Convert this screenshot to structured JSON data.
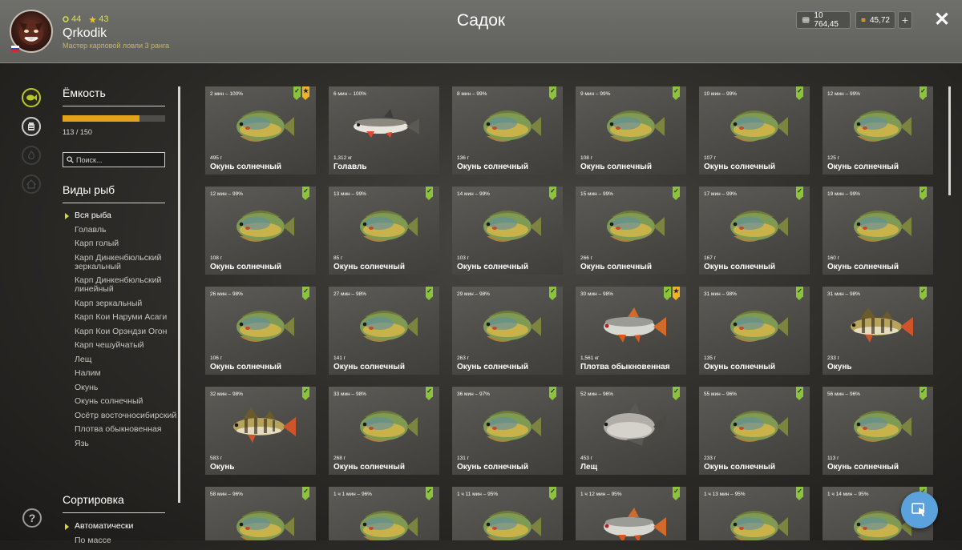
{
  "header": {
    "title": "Садок",
    "username": "Qrkodik",
    "rank": "Мастер карповой ловли 3 ранга",
    "level": "44",
    "stars": "43",
    "silver": "10 764,45",
    "gold": "45,72",
    "plus": "+",
    "close": "✕"
  },
  "sidebar": {
    "capacity_title": "Ёмкость",
    "capacity_text": "113 / 150",
    "capacity_fraction": 0.753,
    "search_placeholder": "Поиск...",
    "species_title": "Виды рыб",
    "species": [
      "Вся рыба",
      "Голавль",
      "Карп голый",
      "Карп Динкенбюльский зеркальный",
      "Карп Динкенбюльский линейный",
      "Карп зеркальный",
      "Карп Кои Наруми Асаги",
      "Карп Кои Орэндзи Огон",
      "Карп чешуйчатый",
      "Лещ",
      "Налим",
      "Окунь",
      "Окунь солнечный",
      "Осётр восточносибирский",
      "Плотва обыкновенная",
      "Язь"
    ],
    "sort_title": "Сортировка",
    "sort_options": [
      "Автоматически",
      "По массе"
    ],
    "help": "?"
  },
  "colors": {
    "accent": "#b7c92a",
    "capacity_bar": "#e2a21c",
    "badge_green": "#8bc43a",
    "badge_orange": "#f0b322",
    "fab": "#5ba1dc"
  },
  "cards": [
    {
      "time": "2 мин – 100%",
      "weight": "495 г",
      "name": "Окунь солнечный",
      "fish": "sunfish",
      "badges": [
        "green",
        "orange"
      ]
    },
    {
      "time": "6 мин – 100%",
      "weight": "1,312 кг",
      "name": "Голавль",
      "fish": "chub",
      "badges": []
    },
    {
      "time": "8 мин – 99%",
      "weight": "136 г",
      "name": "Окунь солнечный",
      "fish": "sunfish",
      "badges": [
        "green"
      ]
    },
    {
      "time": "9 мин – 99%",
      "weight": "108 г",
      "name": "Окунь солнечный",
      "fish": "sunfish",
      "badges": [
        "green"
      ]
    },
    {
      "time": "10 мин – 99%",
      "weight": "107 г",
      "name": "Окунь солнечный",
      "fish": "sunfish",
      "badges": [
        "green"
      ]
    },
    {
      "time": "12 мин – 99%",
      "weight": "125 г",
      "name": "Окунь солнечный",
      "fish": "sunfish",
      "badges": [
        "green"
      ]
    },
    {
      "time": "12 мин – 99%",
      "weight": "108 г",
      "name": "Окунь солнечный",
      "fish": "sunfish",
      "badges": [
        "green"
      ]
    },
    {
      "time": "13 мин – 99%",
      "weight": "85 г",
      "name": "Окунь солнечный",
      "fish": "sunfish",
      "badges": [
        "green"
      ]
    },
    {
      "time": "14 мин – 99%",
      "weight": "103 г",
      "name": "Окунь солнечный",
      "fish": "sunfish",
      "badges": [
        "green"
      ]
    },
    {
      "time": "15 мин – 99%",
      "weight": "266 г",
      "name": "Окунь солнечный",
      "fish": "sunfish",
      "badges": [
        "green"
      ]
    },
    {
      "time": "17 мин – 99%",
      "weight": "167 г",
      "name": "Окунь солнечный",
      "fish": "sunfish",
      "badges": [
        "green"
      ]
    },
    {
      "time": "19 мин – 99%",
      "weight": "160 г",
      "name": "Окунь солнечный",
      "fish": "sunfish",
      "badges": [
        "green"
      ]
    },
    {
      "time": "26 мин – 98%",
      "weight": "106 г",
      "name": "Окунь солнечный",
      "fish": "sunfish",
      "badges": [
        "green"
      ]
    },
    {
      "time": "27 мин – 98%",
      "weight": "141 г",
      "name": "Окунь солнечный",
      "fish": "sunfish",
      "badges": [
        "green"
      ]
    },
    {
      "time": "29 мин – 98%",
      "weight": "263 г",
      "name": "Окунь солнечный",
      "fish": "sunfish",
      "badges": [
        "green"
      ]
    },
    {
      "time": "30 мин – 98%",
      "weight": "1,561 кг",
      "name": "Плотва обыкновенная",
      "fish": "roach",
      "badges": [
        "green",
        "orange"
      ]
    },
    {
      "time": "31 мин – 98%",
      "weight": "135 г",
      "name": "Окунь солнечный",
      "fish": "sunfish",
      "badges": [
        "green"
      ]
    },
    {
      "time": "31 мин – 98%",
      "weight": "233 г",
      "name": "Окунь",
      "fish": "perch",
      "badges": [
        "green"
      ]
    },
    {
      "time": "32 мин – 98%",
      "weight": "583 г",
      "name": "Окунь",
      "fish": "perch",
      "badges": [
        "green"
      ]
    },
    {
      "time": "33 мин – 98%",
      "weight": "268 г",
      "name": "Окунь солнечный",
      "fish": "sunfish",
      "badges": [
        "green"
      ]
    },
    {
      "time": "36 мин – 97%",
      "weight": "131 г",
      "name": "Окунь солнечный",
      "fish": "sunfish",
      "badges": [
        "green"
      ]
    },
    {
      "time": "52 мин – 96%",
      "weight": "453 г",
      "name": "Лещ",
      "fish": "bream",
      "badges": [
        "green"
      ]
    },
    {
      "time": "55 мин – 96%",
      "weight": "233 г",
      "name": "Окунь солнечный",
      "fish": "sunfish",
      "badges": [
        "green"
      ]
    },
    {
      "time": "56 мин – 96%",
      "weight": "113 г",
      "name": "Окунь солнечный",
      "fish": "sunfish",
      "badges": [
        "green"
      ]
    },
    {
      "time": "58 мин – 96%",
      "weight": "",
      "name": "",
      "fish": "sunfish",
      "badges": [
        "green"
      ]
    },
    {
      "time": "1 ч 1 мин – 96%",
      "weight": "",
      "name": "",
      "fish": "sunfish",
      "badges": [
        "green"
      ]
    },
    {
      "time": "1 ч 11 мин – 95%",
      "weight": "",
      "name": "",
      "fish": "sunfish",
      "badges": [
        "green"
      ]
    },
    {
      "time": "1 ч 12 мин – 95%",
      "weight": "",
      "name": "",
      "fish": "roach",
      "badges": [
        "green"
      ]
    },
    {
      "time": "1 ч 13 мин – 95%",
      "weight": "",
      "name": "",
      "fish": "sunfish",
      "badges": [
        "green"
      ]
    },
    {
      "time": "1 ч 14 мин – 95%",
      "weight": "",
      "name": "",
      "fish": "sunfish",
      "badges": [
        "green"
      ]
    }
  ]
}
